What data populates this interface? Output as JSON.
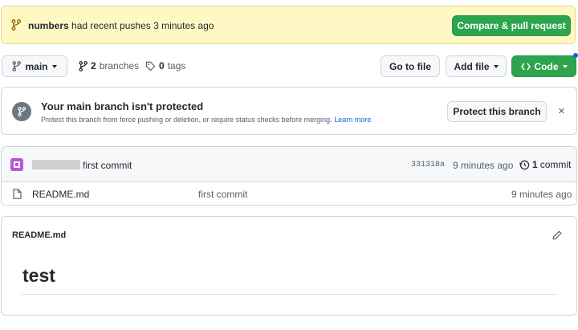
{
  "banner": {
    "branch_name": "numbers",
    "message": " had recent pushes 3 minutes ago",
    "compare_label": "Compare & pull request"
  },
  "toolbar": {
    "branch": "main",
    "branches_count": "2",
    "branches_label": "branches",
    "tags_count": "0",
    "tags_label": "tags",
    "go_to_file": "Go to file",
    "add_file": "Add file",
    "code": "Code"
  },
  "protect": {
    "title": "Your main branch isn't protected",
    "desc": "Protect this branch from force pushing or deletion, or require status checks before merging.",
    "learn_more": "Learn more",
    "button": "Protect this branch",
    "close": "×"
  },
  "commit": {
    "message": "first commit",
    "sha": "331318a",
    "time": "9 minutes ago",
    "count": "1",
    "count_label": "commit"
  },
  "files": [
    {
      "name": "README.md",
      "message": "first commit",
      "time": "9 minutes ago"
    }
  ],
  "readme": {
    "filename": "README.md",
    "heading": "test"
  },
  "colors": {
    "banner_bg": "#fff8c5",
    "green": "#2da44e",
    "link": "#0969da"
  }
}
